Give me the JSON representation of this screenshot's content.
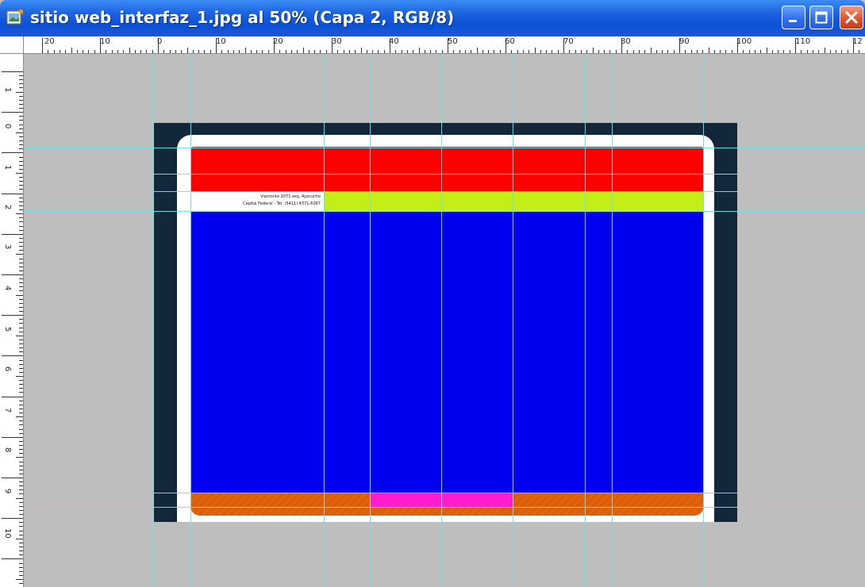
{
  "window": {
    "title": "sitio web_interfaz_1.jpg al 50% (Capa 2, RGB/8)",
    "icon": "photoshop-document-icon",
    "buttons": [
      "minimize-icon",
      "maximize-icon",
      "close-icon"
    ]
  },
  "rulers": {
    "top_labels": [
      "20",
      "10",
      "0",
      "10",
      "20",
      "30",
      "40",
      "50",
      "60",
      "70",
      "80",
      "90",
      "100",
      "110",
      "12"
    ],
    "left_labels": [
      "1",
      "0",
      "1",
      "2",
      "3",
      "4",
      "5",
      "6",
      "7",
      "8",
      "9",
      "10"
    ]
  },
  "document": {
    "address_line_1": "Viamonte 2071 esq. Ayacucho",
    "address_line_2": "Capital Federal - Tel: (5411) 4371-6087",
    "colors": {
      "frame": "#13273a",
      "page": "#ffffff",
      "header": "#ff0000",
      "nav_bar": "#c4ee17",
      "content": "#0000f0",
      "footer": "#e0620a",
      "footer_highlight": "#ff1ccf",
      "guides": "#6fe2e6",
      "workspace": "#bebebe"
    }
  }
}
